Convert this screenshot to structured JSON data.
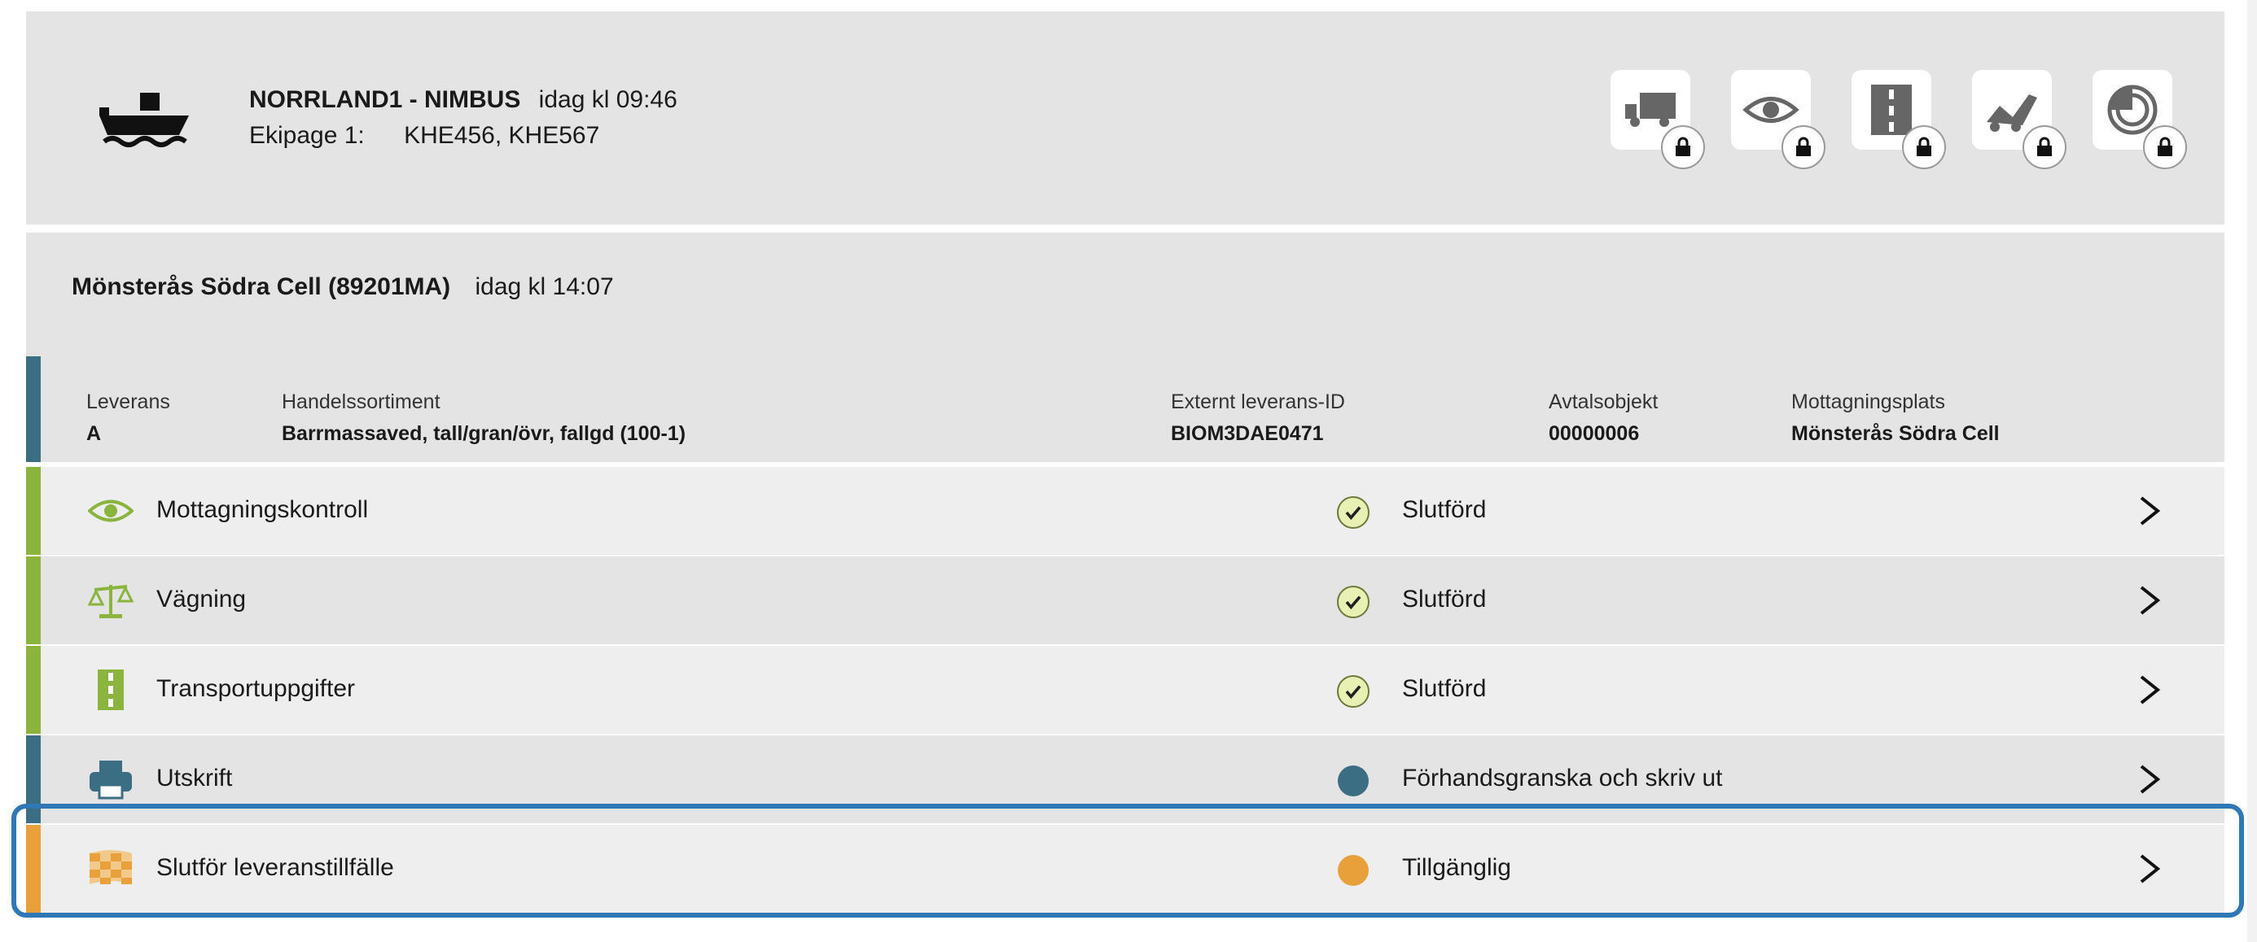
{
  "header": {
    "vessel": "NORRLAND1 - NIMBUS",
    "time": "idag kl 09:46",
    "ekipage_label": "Ekipage 1:",
    "plates": "KHE456, KHE567",
    "vessel_icon": "ship-icon",
    "status_icons": [
      {
        "name": "truck-icon"
      },
      {
        "name": "eye-icon"
      },
      {
        "name": "road-icon"
      },
      {
        "name": "loader-icon"
      },
      {
        "name": "measure-icon"
      }
    ]
  },
  "location": {
    "name": "Mönsterås Södra Cell (89201MA)",
    "time": "idag kl 14:07"
  },
  "delivery": {
    "columns": [
      {
        "label": "Leverans",
        "value": "A"
      },
      {
        "label": "Handelssortiment",
        "value": "Barrmassaved, tall/gran/övr, fallgd (100-1)"
      },
      {
        "label": "Externt leverans-ID",
        "value": "BIOM3DAE0471"
      },
      {
        "label": "Avtalsobjekt",
        "value": "00000006"
      },
      {
        "label": "Mottagningsplats",
        "value": "Mönsterås Södra Cell"
      }
    ]
  },
  "rows": [
    {
      "label": "Mottagningskontroll",
      "status": "Slutförd",
      "icon": "eye-icon",
      "state": "done"
    },
    {
      "label": "Vägning",
      "status": "Slutförd",
      "icon": "scale-icon",
      "state": "done"
    },
    {
      "label": "Transportuppgifter",
      "status": "Slutförd",
      "icon": "road-icon",
      "state": "done"
    },
    {
      "label": "Utskrift",
      "status": "Förhandsgranska och skriv ut",
      "icon": "printer-icon",
      "state": "pending"
    },
    {
      "label": "Slutför leveranstillfälle",
      "status": "Tillgänglig",
      "icon": "checkered-flag-icon",
      "state": "available"
    }
  ],
  "colors": {
    "green": "#8ab43d",
    "blue": "#3b6e82",
    "orange": "#e8a03a",
    "highlight": "#2f77b5"
  }
}
